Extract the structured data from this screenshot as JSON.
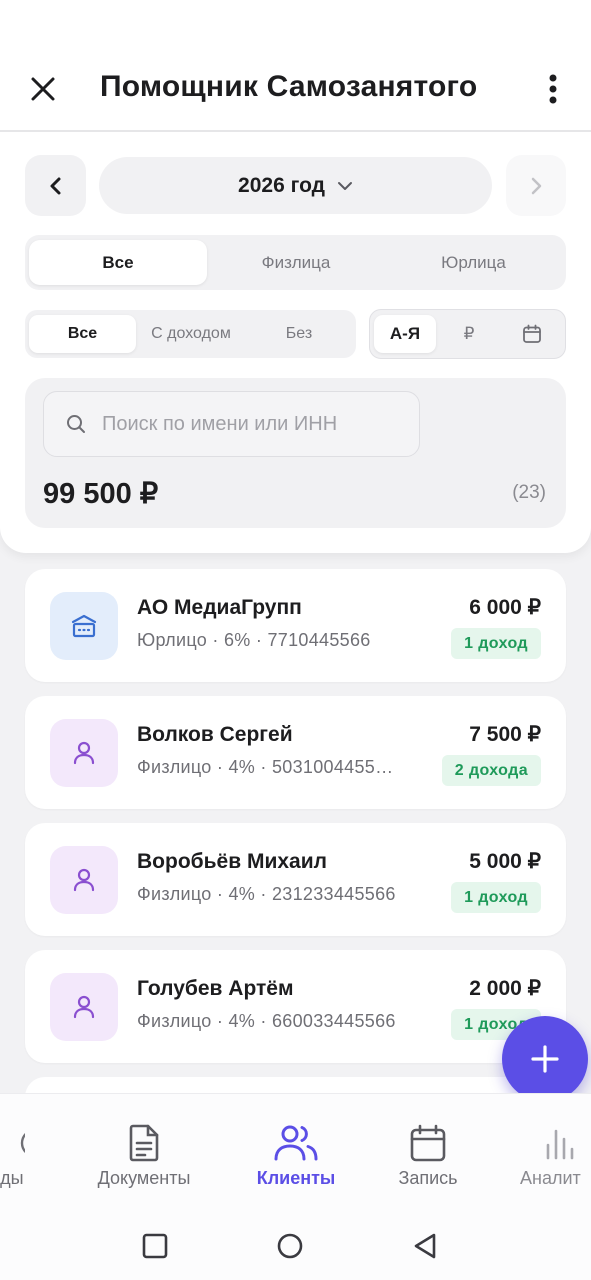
{
  "app": {
    "title": "Помощник Самозанятого"
  },
  "year_selector": {
    "label": "2026 год"
  },
  "type_filter": {
    "options": [
      "Все",
      "Физлица",
      "Юрлица"
    ],
    "selected": "Все"
  },
  "income_filter": {
    "options": [
      "Все",
      "С доходом",
      "Без"
    ],
    "selected": "Все"
  },
  "sort_filter": {
    "options": [
      "А-Я",
      "₽",
      "calendar-icon"
    ],
    "selected": "А-Я"
  },
  "search": {
    "placeholder": "Поиск по имени или ИНН",
    "value": ""
  },
  "summary": {
    "total": "99 500 ₽",
    "count": "(23)"
  },
  "clients": [
    {
      "name": "АО МедиаГрупп",
      "details": "Юрлицо · 6% · 7710445566",
      "amount": "6 000 ₽",
      "badge": "1 доход",
      "type": "org",
      "icon": "building-icon"
    },
    {
      "name": "Волков Сергей",
      "details": "Физлицо · 4% · 5031004455…",
      "amount": "7 500 ₽",
      "badge": "2 дохода",
      "type": "person",
      "icon": "person-icon"
    },
    {
      "name": "Воробьёв Михаил",
      "details": "Физлицо · 4% · 231233445566",
      "amount": "5 000 ₽",
      "badge": "1 доход",
      "type": "person",
      "icon": "person-icon"
    },
    {
      "name": "Голубев Артём",
      "details": "Физлицо · 4% · 660033445566",
      "amount": "2 000 ₽",
      "badge": "1 доход",
      "type": "person",
      "icon": "person-icon"
    }
  ],
  "bottom_nav": {
    "items": [
      {
        "label": "оды",
        "icon": "partial-icon"
      },
      {
        "label": "Документы",
        "icon": "document-icon"
      },
      {
        "label": "Клиенты",
        "icon": "users-icon",
        "active": true
      },
      {
        "label": "Запись",
        "icon": "calendar-icon"
      },
      {
        "label": "Аналит",
        "icon": "chart-icon"
      }
    ]
  },
  "colors": {
    "accent": "#5b4ee6",
    "badge_bg": "#e5f6ec",
    "badge_text": "#1f9a5a"
  }
}
